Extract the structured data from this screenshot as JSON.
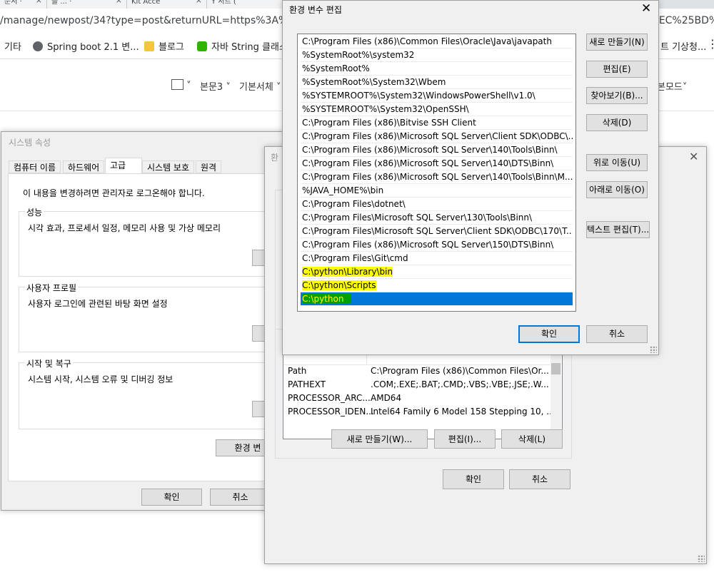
{
  "browser": {
    "tabs": [
      "문서 ·",
      "블 ... ·",
      "Kit Acce",
      "Y 서트 (",
      ""
    ],
    "url_left": "/manage/newpost/34?type=post&returnURL=https%3A%2F%",
    "url_right": "25EC%25BD%",
    "bookmarks": [
      "기타",
      "Spring boot 2.1 변...",
      "블로그",
      "자바 String 클래스",
      "트 기상청..."
    ],
    "toolbar": {
      "image_label": "",
      "body_style": "본문3",
      "font": "기본서체",
      "mode": "본모드"
    }
  },
  "system_properties": {
    "title": "시스템 속성",
    "tabs": [
      "컴퓨터 이름",
      "하드웨어",
      "고급",
      "시스템 보호",
      "원격"
    ],
    "admin_notice": "이 내용을 변경하려면 관리자로 로그온해야 합니다.",
    "performance": {
      "label": "성능",
      "desc": "시각 효과, 프로세서 일정, 메모리 사용 및 가상 메모리"
    },
    "user_profile": {
      "label": "사용자 프로필",
      "desc": "사용자 로그인에 관련된 바탕 화면 설정"
    },
    "startup": {
      "label": "시작 및 복구",
      "desc": "시스템 시작, 시스템 오류 및 디버깅 정보"
    },
    "env_button": "환경 변",
    "ok": "확인",
    "cancel": "취소"
  },
  "env_vars": {
    "title": "환",
    "system_vars": [
      {
        "name": "Path",
        "value": "C:\\Program Files (x86)\\Common Files\\Or..."
      },
      {
        "name": "PATHEXT",
        "value": ".COM;.EXE;.BAT;.CMD;.VBS;.VBE;.JSE;.W..."
      },
      {
        "name": "PROCESSOR_ARC...",
        "value": "AMD64"
      },
      {
        "name": "PROCESSOR_IDEN...",
        "value": "Intel64 Family 6 Model 158 Stepping 10, ..."
      }
    ],
    "new_button": "새로 만들기(W)...",
    "edit_button": "편집(I)...",
    "delete_button": "삭제(L)",
    "ok": "확인",
    "cancel": "취소"
  },
  "edit_env": {
    "title": "환경 변수 편집",
    "entries": [
      "C:\\Program Files (x86)\\Common Files\\Oracle\\Java\\javapath",
      "%SystemRoot%\\system32",
      "%SystemRoot%",
      "%SystemRoot%\\System32\\Wbem",
      "%SYSTEMROOT%\\System32\\WindowsPowerShell\\v1.0\\",
      "%SYSTEMROOT%\\System32\\OpenSSH\\",
      "C:\\Program Files (x86)\\Bitvise SSH Client",
      "C:\\Program Files (x86)\\Microsoft SQL Server\\Client SDK\\ODBC\\...",
      "C:\\Program Files (x86)\\Microsoft SQL Server\\140\\Tools\\Binn\\",
      "C:\\Program Files (x86)\\Microsoft SQL Server\\140\\DTS\\Binn\\",
      "C:\\Program Files (x86)\\Microsoft SQL Server\\140\\Tools\\Binn\\M...",
      "%JAVA_HOME%\\bin",
      "C:\\Program Files\\dotnet\\",
      "C:\\Program Files\\Microsoft SQL Server\\130\\Tools\\Binn\\",
      "C:\\Program Files\\Microsoft SQL Server\\Client SDK\\ODBC\\170\\T...",
      "C:\\Program Files (x86)\\Microsoft SQL Server\\150\\DTS\\Binn\\",
      "C:\\Program Files\\Git\\cmd",
      "C:\\python\\Library\\bin",
      "C:\\python\\Scripts",
      "C:\\python"
    ],
    "buttons": {
      "new": "새로 만들기(N)",
      "edit": "편집(E)",
      "browse": "찾아보기(B)...",
      "delete": "삭제(D)",
      "move_up": "위로 이동(U)",
      "move_down": "아래로 이동(O)",
      "edit_text": "텍스트 편집(T)...",
      "ok": "확인",
      "cancel": "취소"
    },
    "highlight_color": "#ffff00",
    "selection_color": "#0078d7"
  }
}
